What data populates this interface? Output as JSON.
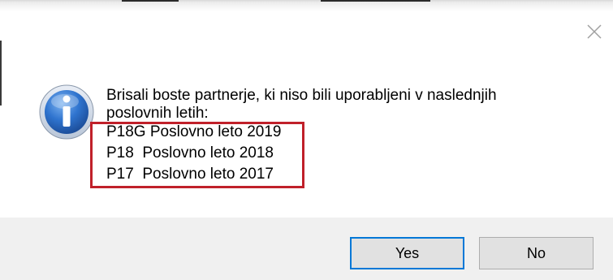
{
  "dialog": {
    "message_lines": [
      "Brisali boste partnerje, ki niso bili uporabljeni v naslednjih",
      "poslovnih letih:"
    ],
    "years": [
      "P18G Poslovno leto 2019",
      "P18  Poslovno leto 2018",
      "P17  Poslovno leto 2017"
    ],
    "icons": {
      "info": "information-icon",
      "close": "close-icon"
    }
  },
  "buttons": {
    "yes": "Yes",
    "no": "No"
  },
  "colors": {
    "highlight_box": "#c0202a",
    "focus_border": "#0078d7",
    "footer_bg": "#f0f0f0",
    "button_bg": "#e1e1e1",
    "info_icon_blue": "#1d5fb8"
  }
}
